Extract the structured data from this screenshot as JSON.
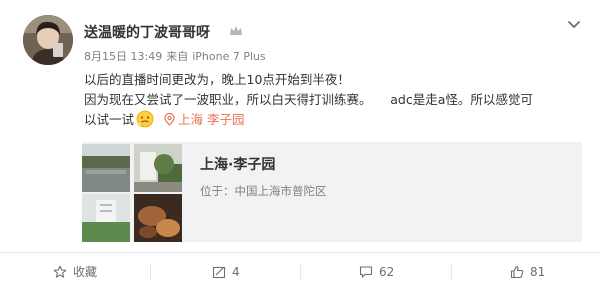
{
  "post": {
    "author_name": "送温暖的丁波哥哥呀",
    "date": "8月15日 13:49",
    "source_prefix": "来自",
    "source_device": "iPhone 7 Plus",
    "text_line1": "以后的直播时间更改为，晚上10点开始到半夜！",
    "text_line2": "因为现在又尝试了一波职业，所以白天得打训练赛。　　adc是走a怪。所以感觉可",
    "text_line3": "以试一试",
    "location_link": "上海 李子园"
  },
  "location_card": {
    "title": "上海·李子园",
    "address": "位于：中国上海市普陀区"
  },
  "actions": {
    "collect_label": "收藏",
    "repost_count": "4",
    "comment_count": "62",
    "like_count": "81"
  },
  "colors": {
    "accent": "#eb7350",
    "meta": "#808080",
    "action": "#696e78",
    "card_bg": "#f2f2f5"
  },
  "icons": [
    "chevron-down-icon",
    "vip-badge-icon",
    "emoji-icon",
    "location-pin-icon",
    "star-icon",
    "repost-icon",
    "comment-icon",
    "like-icon"
  ]
}
